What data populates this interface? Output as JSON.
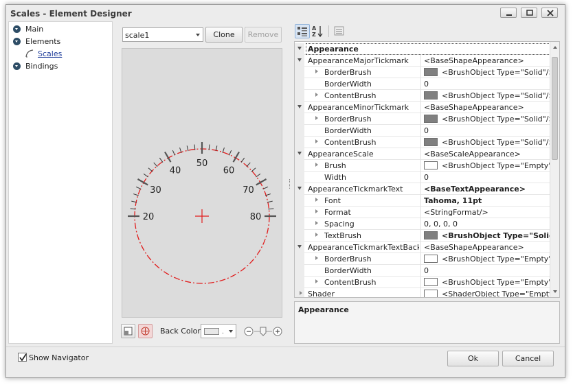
{
  "window": {
    "title": "Scales - Element Designer"
  },
  "tree": {
    "items": [
      {
        "label": "Main",
        "type": "group"
      },
      {
        "label": "Elements",
        "type": "group"
      },
      {
        "label": "Scales",
        "type": "child"
      },
      {
        "label": "Bindings",
        "type": "group"
      }
    ]
  },
  "scale_selector": {
    "value": "scale1",
    "clone_label": "Clone",
    "remove_label": "Remove"
  },
  "gauge": {
    "labels": [
      "20",
      "30",
      "40",
      "50",
      "60",
      "70",
      "80"
    ],
    "scale_start": 20,
    "scale_end": 80,
    "major_color": "#555555",
    "arc_color": "#e11c1c"
  },
  "preview_toolbar": {
    "back_color_label": "Back Color:"
  },
  "property_grid": {
    "rows": [
      {
        "name": "Appearance",
        "value": "",
        "kind": "category"
      },
      {
        "name": "AppearanceMajorTickmark",
        "value": "<BaseShapeAppearance>",
        "level": 0,
        "expander": "open"
      },
      {
        "name": "BorderBrush",
        "value": "<BrushObject Type=\"Solid\"/>",
        "level": 1,
        "expander": "closed",
        "swatch": "#808080"
      },
      {
        "name": "BorderWidth",
        "value": "0",
        "level": 1
      },
      {
        "name": "ContentBrush",
        "value": "<BrushObject Type=\"Solid\"/>",
        "level": 1,
        "expander": "closed",
        "swatch": "#808080"
      },
      {
        "name": "AppearanceMinorTickmark",
        "value": "<BaseShapeAppearance>",
        "level": 0,
        "expander": "open"
      },
      {
        "name": "BorderBrush",
        "value": "<BrushObject Type=\"Solid\"/>",
        "level": 1,
        "expander": "closed",
        "swatch": "#808080"
      },
      {
        "name": "BorderWidth",
        "value": "0",
        "level": 1
      },
      {
        "name": "ContentBrush",
        "value": "<BrushObject Type=\"Solid\"/>",
        "level": 1,
        "expander": "closed",
        "swatch": "#808080"
      },
      {
        "name": "AppearanceScale",
        "value": "<BaseScaleAppearance>",
        "level": 0,
        "expander": "open"
      },
      {
        "name": "Brush",
        "value": "<BrushObject Type=\"Empty\"/>",
        "level": 1,
        "expander": "closed",
        "swatch": "#ffffff"
      },
      {
        "name": "Width",
        "value": "0",
        "level": 1
      },
      {
        "name": "AppearanceTickmarkText",
        "value": "<BaseTextAppearance>",
        "level": 0,
        "expander": "open",
        "bold_value": true
      },
      {
        "name": "Font",
        "value": "Tahoma, 11pt",
        "level": 1,
        "expander": "closed",
        "bold_value": true
      },
      {
        "name": "Format",
        "value": "<StringFormat/>",
        "level": 1,
        "expander": "closed"
      },
      {
        "name": "Spacing",
        "value": "0, 0, 0, 0",
        "level": 1,
        "expander": "closed"
      },
      {
        "name": "TextBrush",
        "value": "<BrushObject Type=\"Solid\"",
        "level": 1,
        "expander": "closed",
        "swatch": "#808080",
        "bold_value": true
      },
      {
        "name": "AppearanceTickmarkTextBackgro",
        "value": "<BaseShapeAppearance>",
        "level": 0,
        "expander": "open"
      },
      {
        "name": "BorderBrush",
        "value": "<BrushObject Type=\"Empty\"/>",
        "level": 1,
        "expander": "closed",
        "swatch": "#ffffff"
      },
      {
        "name": "BorderWidth",
        "value": "0",
        "level": 1
      },
      {
        "name": "ContentBrush",
        "value": "<BrushObject Type=\"Empty\"/>",
        "level": 1,
        "expander": "closed",
        "swatch": "#ffffff"
      },
      {
        "name": "Shader",
        "value": "<ShaderObject Type=\"Empty\"/>",
        "level": 0,
        "expander": "closed",
        "swatch": "#ffffff"
      }
    ],
    "description_title": "Appearance"
  },
  "footer": {
    "show_navigator_label": "Show Navigator",
    "show_navigator_checked": true,
    "ok_label": "Ok",
    "cancel_label": "Cancel"
  }
}
